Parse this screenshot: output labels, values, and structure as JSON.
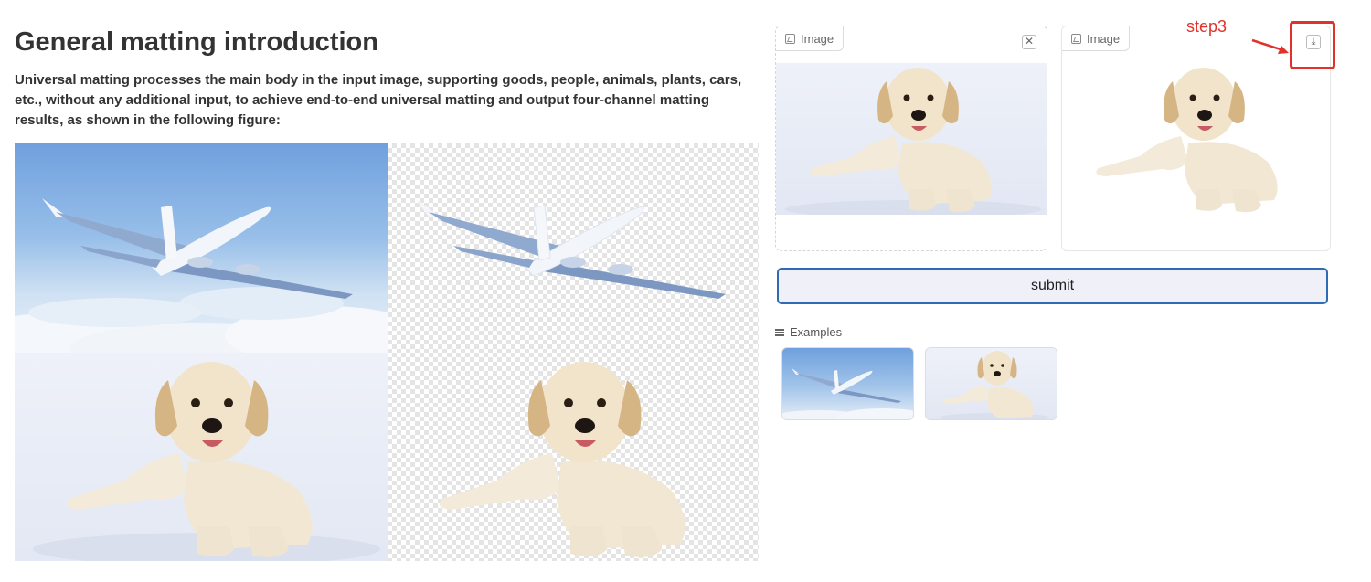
{
  "intro": {
    "title": "General matting introduction",
    "description": "Universal matting processes the main body in the input image, supporting goods, people, animals, plants, cars, etc., without any additional input, to achieve end-to-end universal matting and output four-channel matting results, as shown in the following figure:"
  },
  "input_panel": {
    "label": "Image",
    "icon": "image-icon",
    "action_icon": "close-icon"
  },
  "output_panel": {
    "label": "Image",
    "icon": "image-icon",
    "action_icon": "download-icon"
  },
  "annotation": {
    "text": "step3",
    "color": "#e0312b"
  },
  "submit": {
    "label": "submit"
  },
  "examples": {
    "heading": "Examples",
    "icon": "list-icon"
  },
  "colors": {
    "accent": "#2f6bb5",
    "annotation": "#e0312b",
    "button_bg": "#eff0f8"
  }
}
